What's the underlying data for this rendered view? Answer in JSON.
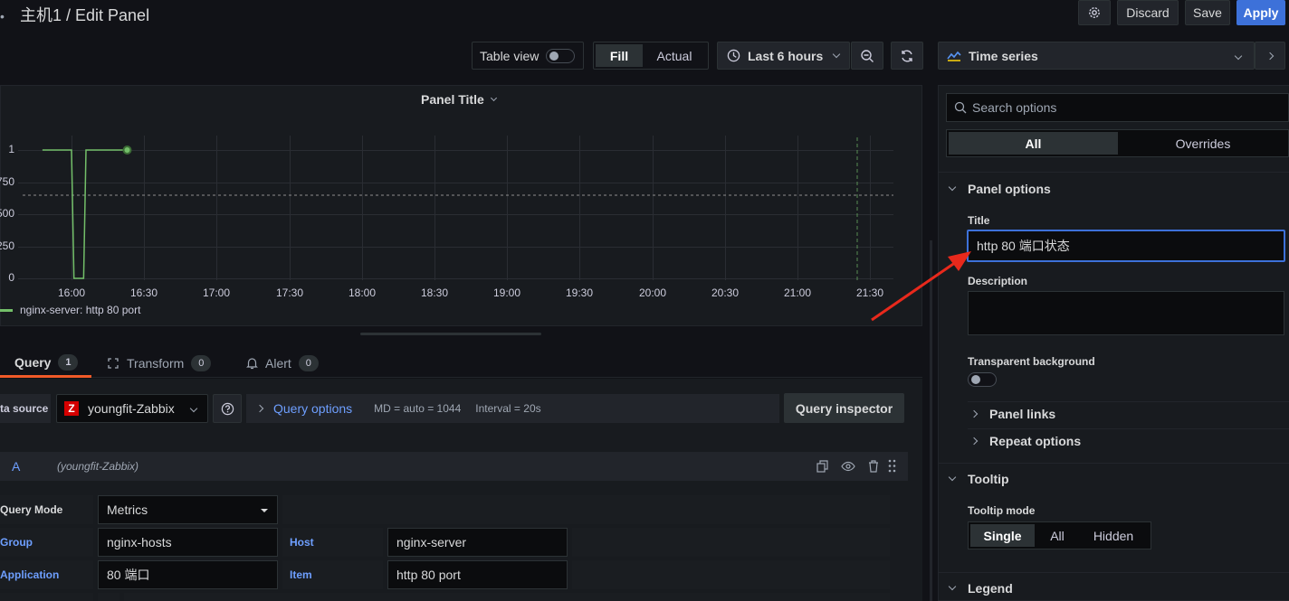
{
  "header": {
    "title": "主机1 / Edit Panel",
    "discard": "Discard",
    "save": "Save",
    "apply": "Apply"
  },
  "toolbar": {
    "table_view": "Table view",
    "fill": "Fill",
    "actual": "Actual",
    "time_range": "Last 6 hours",
    "viz": "Time series"
  },
  "panel": {
    "title": "Panel Title",
    "legend": "nginx-server: http 80 port"
  },
  "chart_data": {
    "type": "line",
    "x_ticks": [
      "16:00",
      "16:30",
      "17:00",
      "17:30",
      "18:00",
      "18:30",
      "19:00",
      "19:30",
      "20:00",
      "20:30",
      "21:00",
      "21:30"
    ],
    "y_ticks": [
      "0",
      "250",
      "500",
      "750",
      "1"
    ],
    "series": [
      {
        "name": "nginx-server: http 80 port",
        "color": "#73bf69",
        "x": [
          "15:48",
          "16:00",
          "16:01",
          "16:05",
          "16:06",
          "16:23"
        ],
        "y": [
          1,
          1,
          0,
          0,
          1,
          1
        ]
      }
    ],
    "threshold_line": 0.65
  },
  "query_tabs": [
    {
      "label": "Query",
      "count": "1"
    },
    {
      "label": "Transform",
      "count": "0"
    },
    {
      "label": "Alert",
      "count": "0"
    }
  ],
  "query": {
    "data_source_label": "ta source",
    "data_source": "youngfit-Zabbix",
    "query_options": "Query options",
    "md": "MD = auto = 1044",
    "interval": "Interval = 20s",
    "inspector": "Query inspector",
    "ref": "A",
    "ref_ds": "(youngfit-Zabbix)",
    "mode_label": "Query Mode",
    "mode_value": "Metrics",
    "group_label": "Group",
    "group_value": "nginx-hosts",
    "host_label": "Host",
    "host_value": "nginx-server",
    "app_label": "Application",
    "app_value": "80 端口",
    "item_label": "Item",
    "item_value": "http 80 port"
  },
  "options": {
    "search_placeholder": "Search options",
    "tab_all": "All",
    "tab_overrides": "Overrides",
    "panel_options": "Panel options",
    "title_label": "Title",
    "title_value": "http 80 端口状态",
    "description_label": "Description",
    "transparent_label": "Transparent background",
    "panel_links": "Panel links",
    "repeat_options": "Repeat options",
    "tooltip": "Tooltip",
    "tooltip_mode_label": "Tooltip mode",
    "tooltip_modes": [
      "Single",
      "All",
      "Hidden"
    ],
    "legend": "Legend"
  },
  "colors": {
    "accent": "#3d71d9",
    "series": "#73bf69",
    "annotation_arrow": "#e8291c"
  }
}
